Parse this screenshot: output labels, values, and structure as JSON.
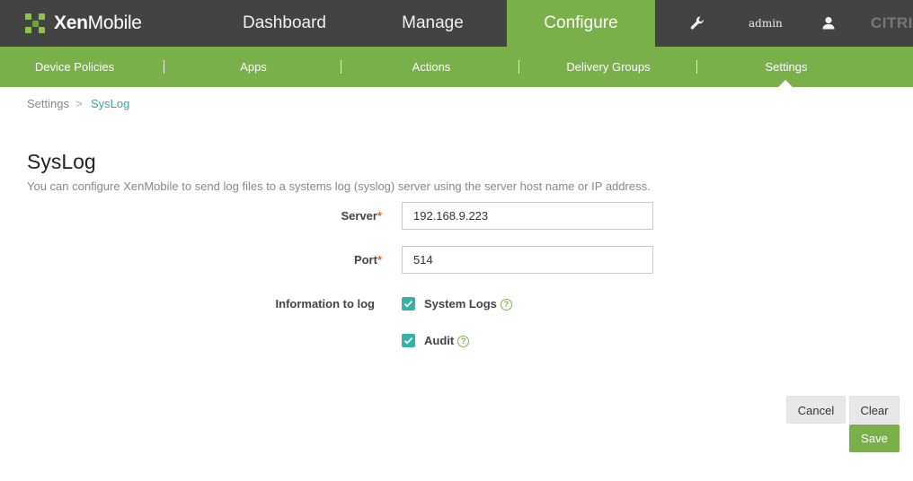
{
  "app": {
    "logo_text_bold": "Xen",
    "logo_text_rest": "Mobile",
    "brand_color": "#79b04a",
    "topbar_color": "#434343"
  },
  "topnav": {
    "items": [
      {
        "label": "Dashboard"
      },
      {
        "label": "Manage"
      },
      {
        "label": "Configure"
      }
    ],
    "active": "Configure",
    "user": "admin",
    "vendor": "CITRIX",
    "icons": [
      "wrench-icon",
      "user-icon"
    ]
  },
  "subnav": {
    "items": [
      {
        "label": "Device Policies"
      },
      {
        "label": "Apps"
      },
      {
        "label": "Actions"
      },
      {
        "label": "Delivery Groups"
      },
      {
        "label": "Settings"
      }
    ],
    "active": "Settings"
  },
  "breadcrumb": {
    "root": "Settings",
    "separator": ">",
    "current": "SysLog"
  },
  "page": {
    "title": "SysLog",
    "description": "You can configure XenMobile to send log files to a systems log (syslog) server using the server host name or IP address."
  },
  "form": {
    "server": {
      "label": "Server",
      "required_mark": "*",
      "value": "192.168.9.223"
    },
    "port": {
      "label": "Port",
      "required_mark": "*",
      "value": "514"
    },
    "info_label": "Information to log",
    "options": [
      {
        "label": "System Logs",
        "checked": true
      },
      {
        "label": "Audit",
        "checked": true
      }
    ],
    "help_glyph": "?"
  },
  "buttons": {
    "cancel": "Cancel",
    "clear": "Clear",
    "save": "Save"
  }
}
